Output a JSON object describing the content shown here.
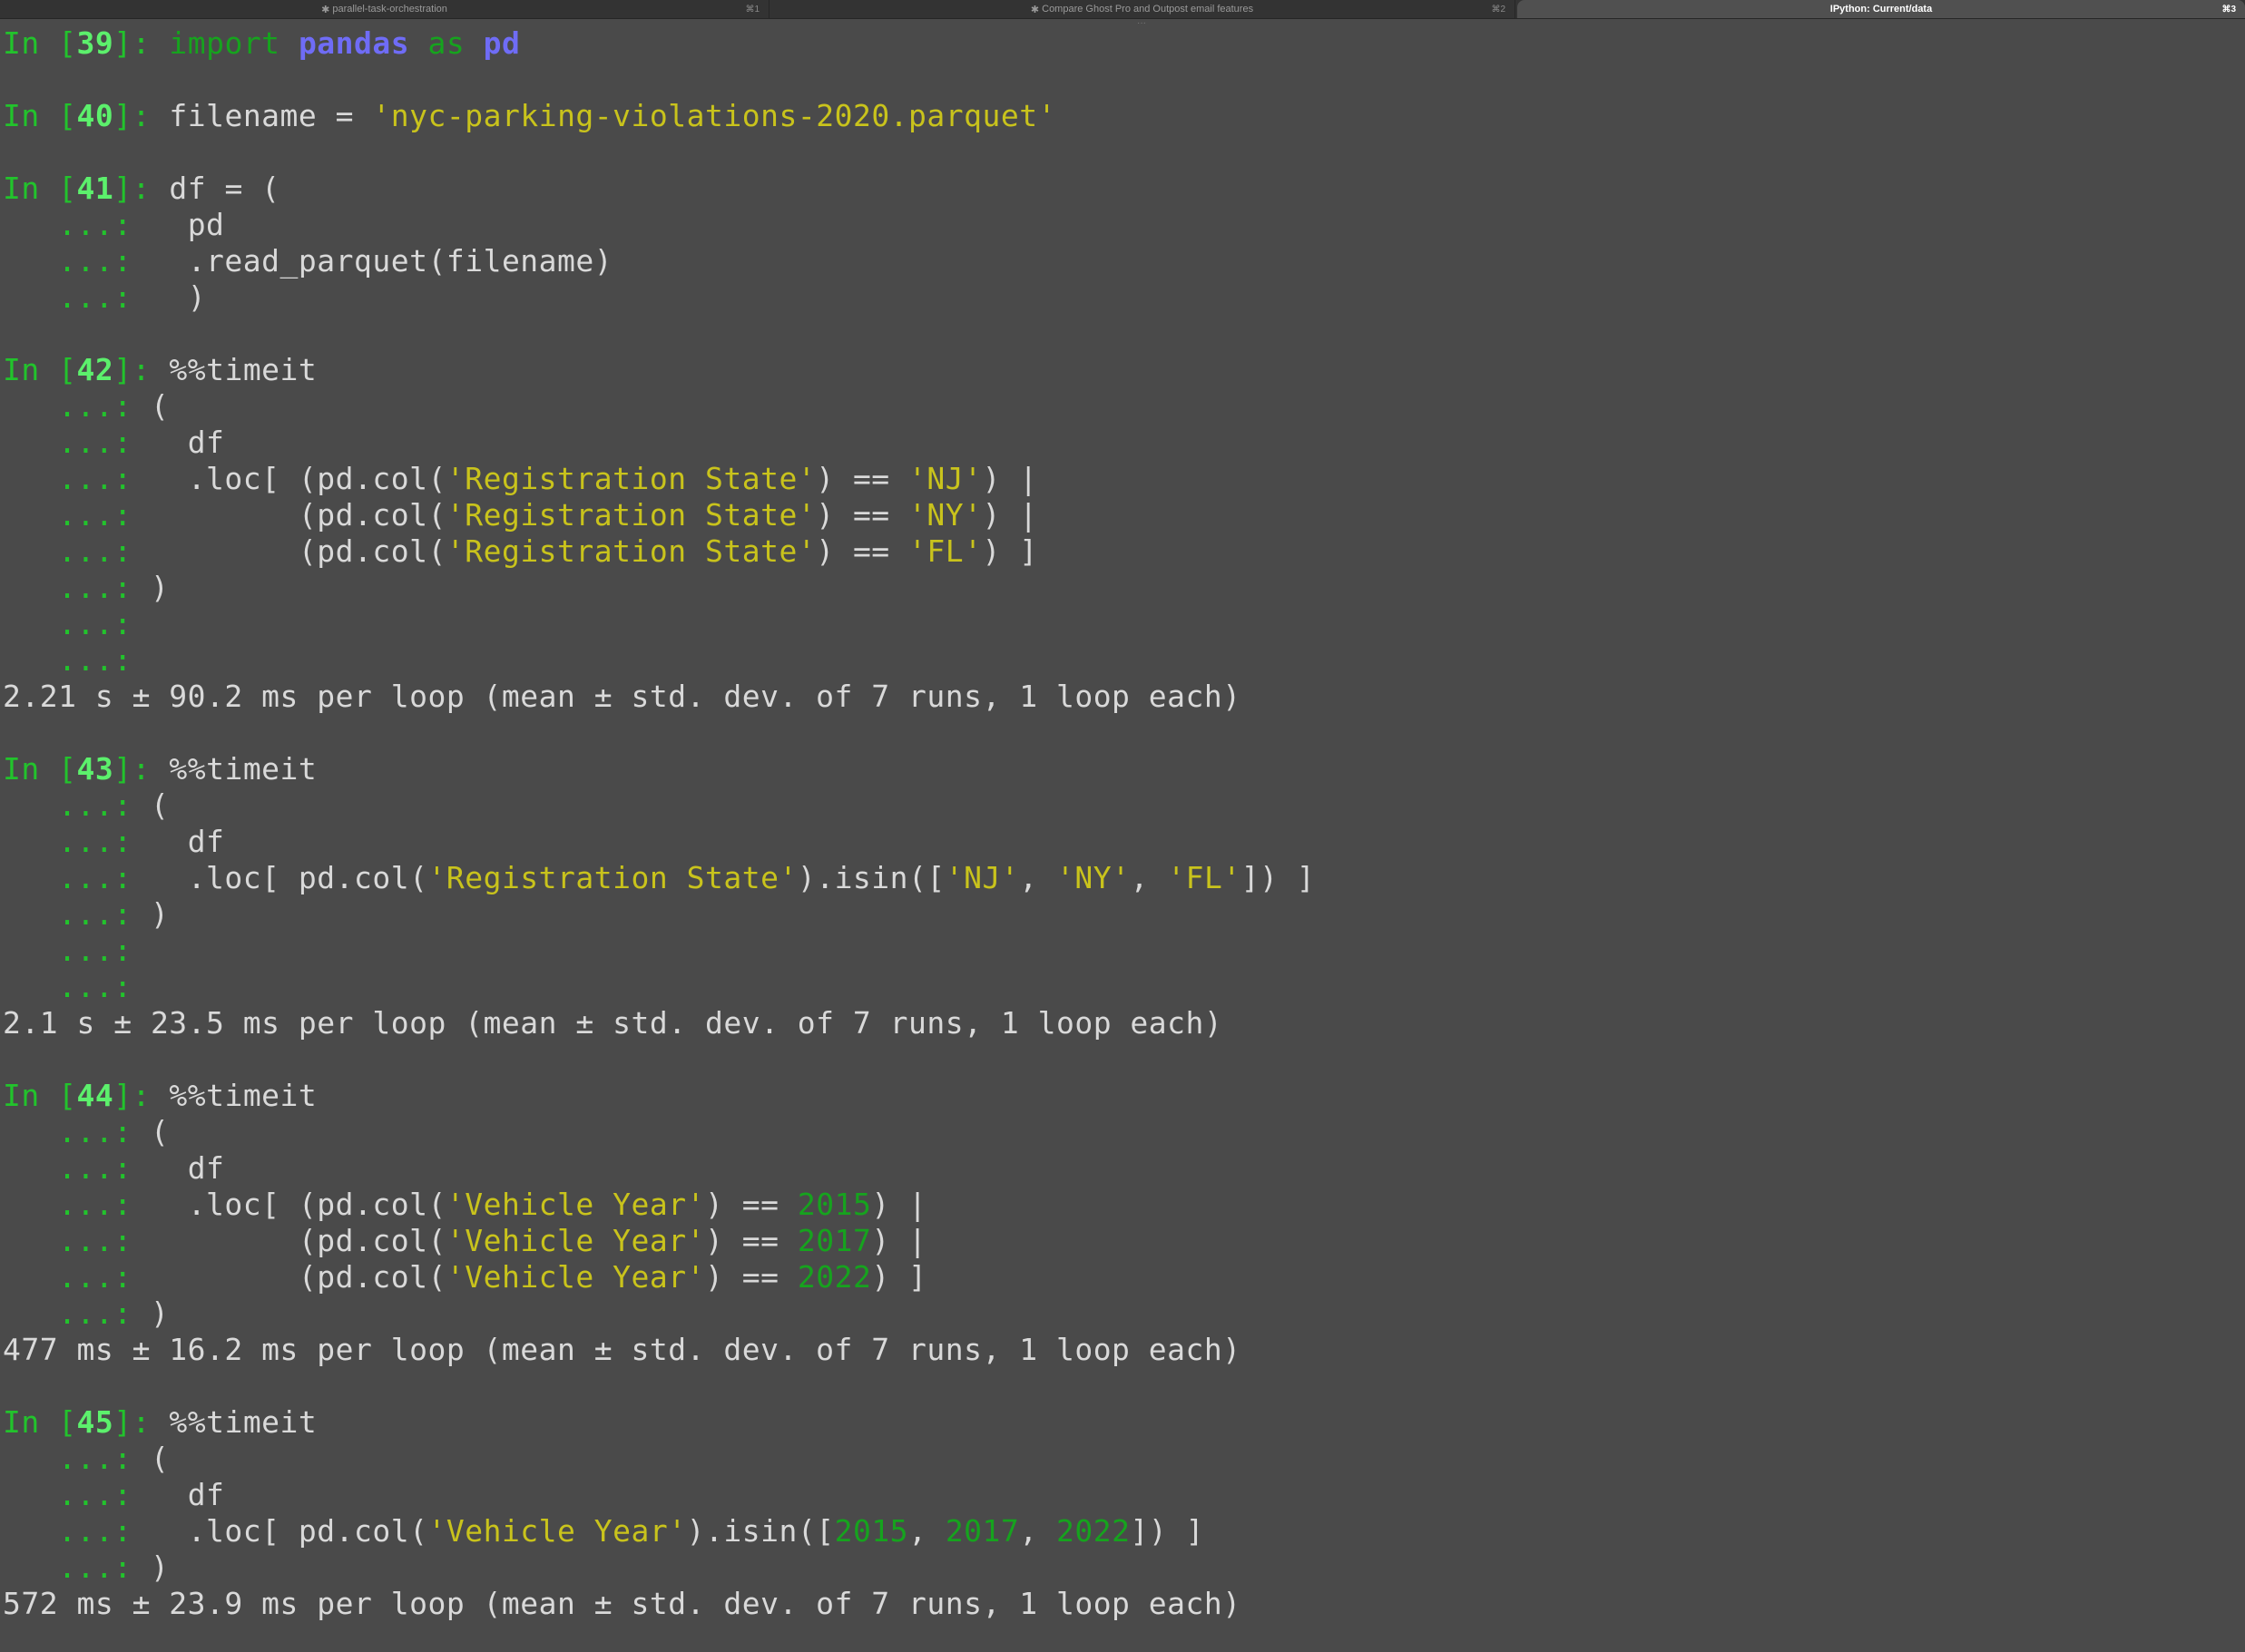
{
  "tabs": [
    {
      "label": "parallel-task-orchestration",
      "shortcut": "⌘1",
      "active": false
    },
    {
      "label": "Compare Ghost Pro and Outpost email features",
      "shortcut": "⌘2",
      "active": false
    },
    {
      "label": "IPython: Current/data",
      "shortcut": "⌘3",
      "active": true
    }
  ],
  "grip_glyph": "···",
  "colors": {
    "background": "#4a4a4a",
    "prompt": "#22c32c",
    "prompt_number": "#5cf06c",
    "string": "#c9c31c",
    "keyword": "#16a31e",
    "name": "#6f6cf6",
    "text": "#d9d9d9"
  },
  "lines": [
    [
      {
        "t": "In [",
        "c": "g"
      },
      {
        "t": "39",
        "c": "gb"
      },
      {
        "t": "]: ",
        "c": "g"
      },
      {
        "t": "import",
        "c": "kw"
      },
      {
        "t": " "
      },
      {
        "t": "pandas",
        "c": "bl"
      },
      {
        "t": " "
      },
      {
        "t": "as",
        "c": "kw"
      },
      {
        "t": " "
      },
      {
        "t": "pd",
        "c": "bl"
      }
    ],
    [],
    [
      {
        "t": "In [",
        "c": "g"
      },
      {
        "t": "40",
        "c": "gb"
      },
      {
        "t": "]: ",
        "c": "g"
      },
      {
        "t": "filename = "
      },
      {
        "t": "'nyc-parking-violations-2020.parquet'",
        "c": "y"
      }
    ],
    [],
    [
      {
        "t": "In [",
        "c": "g"
      },
      {
        "t": "41",
        "c": "gb"
      },
      {
        "t": "]: ",
        "c": "g"
      },
      {
        "t": "df = ("
      }
    ],
    [
      {
        "t": "   ...: ",
        "c": "g"
      },
      {
        "t": "  pd"
      }
    ],
    [
      {
        "t": "   ...: ",
        "c": "g"
      },
      {
        "t": "  .read_parquet(filename)"
      }
    ],
    [
      {
        "t": "   ...: ",
        "c": "g"
      },
      {
        "t": "  )"
      }
    ],
    [],
    [
      {
        "t": "In [",
        "c": "g"
      },
      {
        "t": "42",
        "c": "gb"
      },
      {
        "t": "]: ",
        "c": "g"
      },
      {
        "t": "%%timeit"
      }
    ],
    [
      {
        "t": "   ...: ",
        "c": "g"
      },
      {
        "t": "("
      }
    ],
    [
      {
        "t": "   ...: ",
        "c": "g"
      },
      {
        "t": "  df"
      }
    ],
    [
      {
        "t": "   ...: ",
        "c": "g"
      },
      {
        "t": "  .loc[ (pd.col("
      },
      {
        "t": "'Registration State'",
        "c": "y"
      },
      {
        "t": ") == "
      },
      {
        "t": "'NJ'",
        "c": "y"
      },
      {
        "t": ") |"
      }
    ],
    [
      {
        "t": "   ...: ",
        "c": "g"
      },
      {
        "t": "        (pd.col("
      },
      {
        "t": "'Registration State'",
        "c": "y"
      },
      {
        "t": ") == "
      },
      {
        "t": "'NY'",
        "c": "y"
      },
      {
        "t": ") |"
      }
    ],
    [
      {
        "t": "   ...: ",
        "c": "g"
      },
      {
        "t": "        (pd.col("
      },
      {
        "t": "'Registration State'",
        "c": "y"
      },
      {
        "t": ") == "
      },
      {
        "t": "'FL'",
        "c": "y"
      },
      {
        "t": ") ]"
      }
    ],
    [
      {
        "t": "   ...: ",
        "c": "g"
      },
      {
        "t": ")"
      }
    ],
    [
      {
        "t": "   ...:",
        "c": "g"
      }
    ],
    [
      {
        "t": "   ...:",
        "c": "g"
      }
    ],
    [
      {
        "t": "2.21 s ± 90.2 ms per loop (mean ± std. dev. of 7 runs, 1 loop each)"
      }
    ],
    [],
    [
      {
        "t": "In [",
        "c": "g"
      },
      {
        "t": "43",
        "c": "gb"
      },
      {
        "t": "]: ",
        "c": "g"
      },
      {
        "t": "%%timeit"
      }
    ],
    [
      {
        "t": "   ...: ",
        "c": "g"
      },
      {
        "t": "("
      }
    ],
    [
      {
        "t": "   ...: ",
        "c": "g"
      },
      {
        "t": "  df"
      }
    ],
    [
      {
        "t": "   ...: ",
        "c": "g"
      },
      {
        "t": "  .loc[ pd.col("
      },
      {
        "t": "'Registration State'",
        "c": "y"
      },
      {
        "t": ").isin(["
      },
      {
        "t": "'NJ'",
        "c": "y"
      },
      {
        "t": ", "
      },
      {
        "t": "'NY'",
        "c": "y"
      },
      {
        "t": ", "
      },
      {
        "t": "'FL'",
        "c": "y"
      },
      {
        "t": "]) ]"
      }
    ],
    [
      {
        "t": "   ...: ",
        "c": "g"
      },
      {
        "t": ")"
      }
    ],
    [
      {
        "t": "   ...:",
        "c": "g"
      }
    ],
    [
      {
        "t": "   ...:",
        "c": "g"
      }
    ],
    [
      {
        "t": "2.1 s ± 23.5 ms per loop (mean ± std. dev. of 7 runs, 1 loop each)"
      }
    ],
    [],
    [
      {
        "t": "In [",
        "c": "g"
      },
      {
        "t": "44",
        "c": "gb"
      },
      {
        "t": "]: ",
        "c": "g"
      },
      {
        "t": "%%timeit"
      }
    ],
    [
      {
        "t": "   ...: ",
        "c": "g"
      },
      {
        "t": "("
      }
    ],
    [
      {
        "t": "   ...: ",
        "c": "g"
      },
      {
        "t": "  df"
      }
    ],
    [
      {
        "t": "   ...: ",
        "c": "g"
      },
      {
        "t": "  .loc[ (pd.col("
      },
      {
        "t": "'Vehicle Year'",
        "c": "y"
      },
      {
        "t": ") == "
      },
      {
        "t": "2015",
        "c": "kw"
      },
      {
        "t": ") |"
      }
    ],
    [
      {
        "t": "   ...: ",
        "c": "g"
      },
      {
        "t": "        (pd.col("
      },
      {
        "t": "'Vehicle Year'",
        "c": "y"
      },
      {
        "t": ") == "
      },
      {
        "t": "2017",
        "c": "kw"
      },
      {
        "t": ") |"
      }
    ],
    [
      {
        "t": "   ...: ",
        "c": "g"
      },
      {
        "t": "        (pd.col("
      },
      {
        "t": "'Vehicle Year'",
        "c": "y"
      },
      {
        "t": ") == "
      },
      {
        "t": "2022",
        "c": "kw"
      },
      {
        "t": ") ]"
      }
    ],
    [
      {
        "t": "   ...: ",
        "c": "g"
      },
      {
        "t": ")"
      }
    ],
    [
      {
        "t": "477 ms ± 16.2 ms per loop (mean ± std. dev. of 7 runs, 1 loop each)"
      }
    ],
    [],
    [
      {
        "t": "In [",
        "c": "g"
      },
      {
        "t": "45",
        "c": "gb"
      },
      {
        "t": "]: ",
        "c": "g"
      },
      {
        "t": "%%timeit"
      }
    ],
    [
      {
        "t": "   ...: ",
        "c": "g"
      },
      {
        "t": "("
      }
    ],
    [
      {
        "t": "   ...: ",
        "c": "g"
      },
      {
        "t": "  df"
      }
    ],
    [
      {
        "t": "   ...: ",
        "c": "g"
      },
      {
        "t": "  .loc[ pd.col("
      },
      {
        "t": "'Vehicle Year'",
        "c": "y"
      },
      {
        "t": ").isin(["
      },
      {
        "t": "2015",
        "c": "kw"
      },
      {
        "t": ", "
      },
      {
        "t": "2017",
        "c": "kw"
      },
      {
        "t": ", "
      },
      {
        "t": "2022",
        "c": "kw"
      },
      {
        "t": "]) ]"
      }
    ],
    [
      {
        "t": "   ...: ",
        "c": "g"
      },
      {
        "t": ")"
      }
    ],
    [
      {
        "t": "572 ms ± 23.9 ms per loop (mean ± std. dev. of 7 runs, 1 loop each)"
      }
    ]
  ]
}
